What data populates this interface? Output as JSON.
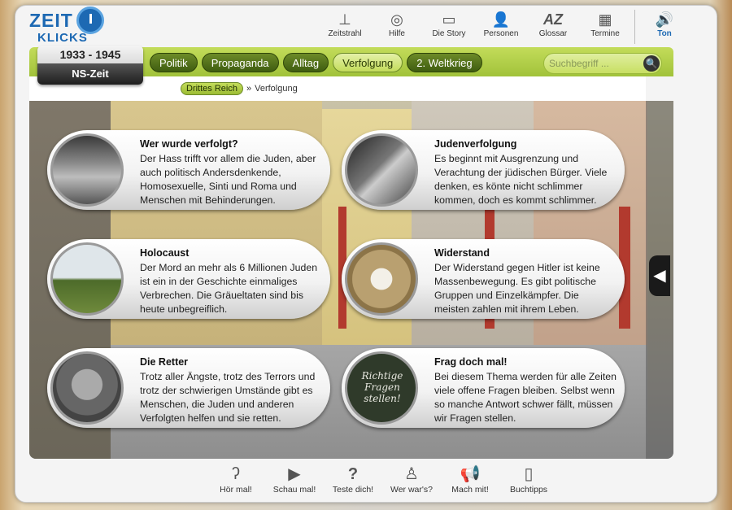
{
  "logo": {
    "line1": "ZEIT",
    "line2": "KLICKS"
  },
  "topnav": [
    {
      "label": "Zeitstrahl",
      "icon": "timeline-icon",
      "glyph": "⊥"
    },
    {
      "label": "Hilfe",
      "icon": "help-ring-icon",
      "glyph": "◎"
    },
    {
      "label": "Die Story",
      "icon": "story-icon",
      "glyph": "▭"
    },
    {
      "label": "Personen",
      "icon": "person-icon",
      "glyph": "👤"
    },
    {
      "label": "Glossar",
      "icon": "glossary-icon",
      "glyph": "AZ"
    },
    {
      "label": "Termine",
      "icon": "calendar-icon",
      "glyph": "▦"
    }
  ],
  "sound": {
    "label": "Ton",
    "glyph": "🔊"
  },
  "era": {
    "years": "1933 - 1945",
    "name": "NS-Zeit"
  },
  "tabs": [
    {
      "label": "Politik",
      "active": false
    },
    {
      "label": "Propaganda",
      "active": false
    },
    {
      "label": "Alltag",
      "active": false
    },
    {
      "label": "Verfolgung",
      "active": true
    },
    {
      "label": "2. Weltkrieg",
      "active": false
    }
  ],
  "search": {
    "placeholder": "Suchbegriff ...",
    "button": "🔍"
  },
  "breadcrumb": {
    "root": "Drittes Reich",
    "sep": "»",
    "current": "Verfolgung"
  },
  "cards": [
    {
      "title": "Wer wurde verfolgt?",
      "text": "Der Hass trifft vor allem die Juden, aber auch politisch Andersdenkende, Homosexuelle, Sinti und Roma und Menschen mit Behinderungen."
    },
    {
      "title": "Judenverfolgung",
      "text": "Es beginnt mit Ausgrenzung und Verachtung der jüdischen Bürger. Viele denken, es könte nicht schlimmer kommen, doch es kommt schlimmer."
    },
    {
      "title": "Holocaust",
      "text": "Der Mord an mehr als 6 Millionen Juden ist ein in der Geschichte einmaliges Verbrechen. Die Gräueltaten sind bis heute unbegreiflich."
    },
    {
      "title": "Widerstand",
      "text": "Der Widerstand gegen Hitler ist keine Massenbewegung. Es gibt politische Gruppen und Einzelkämpfer. Die meisten zahlen mit ihrem Leben."
    },
    {
      "title": "Die Retter",
      "text": "Trotz aller Ängste, trotz des Terrors und trotz der schwierigen Umstände gibt es Menschen, die Juden und anderen Verfolgten helfen und sie retten."
    },
    {
      "title": "Frag doch mal!",
      "text": "Bei diesem Thema werden für alle Zeiten viele offene Fragen bleiben. Selbst wenn so manche Antwort schwer fällt, müssen wir Fragen stellen.",
      "chalk": "Richtige Fragen stellen!"
    }
  ],
  "bottomnav": [
    {
      "label": "Hör mal!",
      "icon": "ear-icon",
      "glyph": "ʔ"
    },
    {
      "label": "Schau mal!",
      "icon": "play-video-icon",
      "glyph": "▶"
    },
    {
      "label": "Teste dich!",
      "icon": "quiz-icon",
      "glyph": "?"
    },
    {
      "label": "Wer war's?",
      "icon": "person-outline-icon",
      "glyph": "♙"
    },
    {
      "label": "Mach mit!",
      "icon": "megaphone-icon",
      "glyph": "📢"
    },
    {
      "label": "Buchtipps",
      "icon": "book-icon",
      "glyph": "▯"
    }
  ],
  "colors": {
    "accent_blue": "#1d69b3",
    "bar_green": "#a1c23a",
    "tab_dark": "#3f5d10"
  }
}
